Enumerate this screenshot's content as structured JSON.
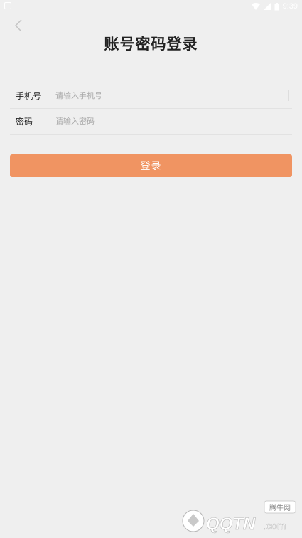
{
  "status_bar": {
    "time": "9:39"
  },
  "header": {
    "title": "账号密码登录"
  },
  "form": {
    "phone_label": "手机号",
    "phone_placeholder": "请输入手机号",
    "password_label": "密码",
    "password_placeholder": "请输入密码",
    "login_label": "登录"
  },
  "watermark": {
    "brand": "QQTN",
    "domain": ".com",
    "badge": "腾牛网"
  },
  "colors": {
    "background": "#efefef",
    "accent": "#f09462"
  }
}
